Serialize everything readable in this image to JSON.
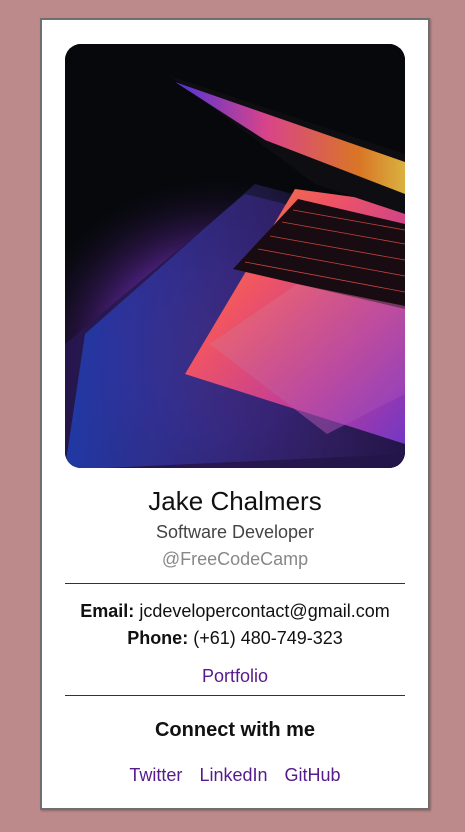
{
  "profile": {
    "name": "Jake Chalmers",
    "role": "Software Developer",
    "handle": "@FreeCodeCamp",
    "photo_alt": "laptop photo"
  },
  "contact": {
    "email_label": "Email:",
    "email_value": "jcdevelopercontact@gmail.com",
    "phone_label": "Phone:",
    "phone_value": "(+61) 480-749-323",
    "portfolio_label": "Portfolio"
  },
  "connect": {
    "heading": "Connect with me",
    "links": [
      "Twitter",
      "LinkedIn",
      "GitHub"
    ]
  },
  "colors": {
    "page_background": "#bc8a8a",
    "card_background": "#ffffff",
    "link": "#551a8b"
  }
}
